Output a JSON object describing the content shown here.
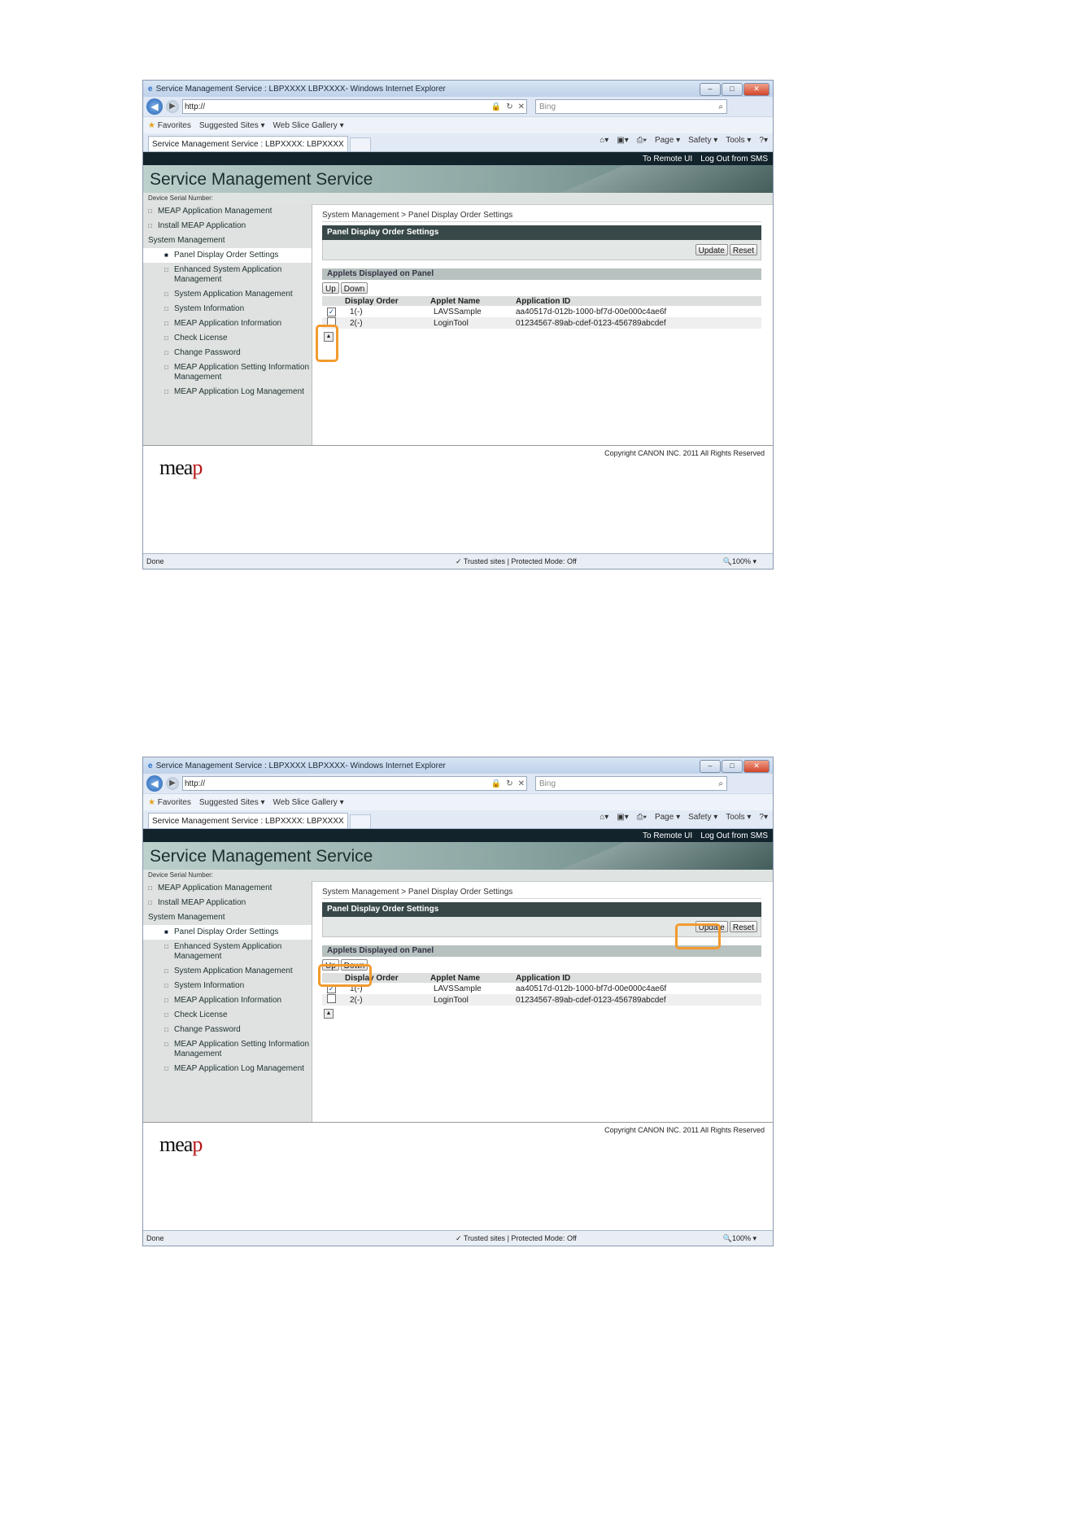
{
  "window": {
    "title": "Service Management Service : LBPXXXX LBPXXXX- Windows Internet Explorer",
    "address": "http://",
    "search_placeholder": "Bing",
    "favorites_label": "Favorites",
    "suggested_sites": "Suggested Sites ▾",
    "web_slice": "Web Slice Gallery ▾",
    "tab_title": "Service Management Service : LBPXXXX: LBPXXXX",
    "cmd_page": "Page ▾",
    "cmd_safety": "Safety ▾",
    "cmd_tools": "Tools ▾",
    "cmd_help": "?▾"
  },
  "header": {
    "remote_ui": "To Remote UI",
    "logout": "Log Out from SMS",
    "app_title": "Service Management Service",
    "serial_label": "Device Serial Number:"
  },
  "sidebar": {
    "items": [
      "MEAP Application Management",
      "Install MEAP Application",
      "System Management",
      "Panel Display Order Settings",
      "Enhanced System Application Management",
      "System Application Management",
      "System Information",
      "MEAP Application Information",
      "Check License",
      "Change Password",
      "MEAP Application Setting Information Management",
      "MEAP Application Log Management"
    ]
  },
  "main": {
    "breadcrumb": "System Management > Panel Display Order Settings",
    "panel_title": "Panel Display Order Settings",
    "update_label": "Update",
    "reset_label": "Reset",
    "applets_title": "Applets Displayed on Panel",
    "up_label": "Up",
    "down_label": "Down",
    "columns": [
      "Display Order",
      "Applet Name",
      "Application ID"
    ],
    "rows": [
      {
        "order": "1(-)",
        "name": "LAVSSample",
        "id": "aa40517d-012b-1000-bf7d-00e000c4ae6f",
        "checked": true
      },
      {
        "order": "2(-)",
        "name": "LoginTool",
        "id": "01234567-89ab-cdef-0123-456789abcdef",
        "checked": false
      }
    ]
  },
  "footer": {
    "copyright": "Copyright CANON INC. 2011 All Rights Reserved",
    "logo_a": "mea",
    "logo_b": "p"
  },
  "status": {
    "done": "Done",
    "zone": "✓ Trusted sites | Protected Mode: Off",
    "zoom": "100%"
  },
  "colors": {
    "highlight": "#f29a2e",
    "banner_dark": "#12232c",
    "panel_header": "#384848"
  }
}
